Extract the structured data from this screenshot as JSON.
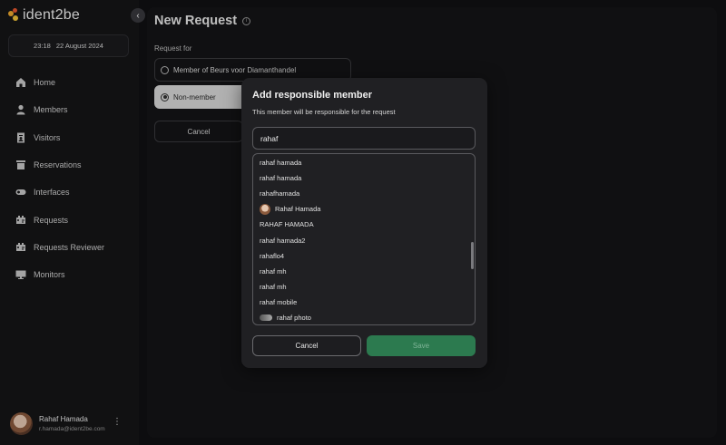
{
  "app": {
    "logo_text": "ident2be",
    "date_time": {
      "time": "23:18",
      "date": "22 August 2024"
    }
  },
  "sidebar": {
    "items": [
      {
        "label": "Home",
        "icon": "home-icon"
      },
      {
        "label": "Members",
        "icon": "person-icon"
      },
      {
        "label": "Visitors",
        "icon": "visitor-badge-icon"
      },
      {
        "label": "Reservations",
        "icon": "reservation-icon"
      },
      {
        "label": "Interfaces",
        "icon": "toggle-icon"
      },
      {
        "label": "Requests",
        "icon": "request-icon"
      },
      {
        "label": "Requests Reviewer",
        "icon": "request-reviewer-icon"
      },
      {
        "label": "Monitors",
        "icon": "monitor-icon"
      }
    ],
    "user": {
      "name": "Rahaf Hamada",
      "email": "r.hamada@ident2be.com"
    }
  },
  "page": {
    "title": "New Request",
    "request_for_label": "Request for",
    "options": [
      "Member of Beurs voor Diamanthandel",
      "Non-member"
    ],
    "selected_option": "Non-member",
    "cancel_label": "Cancel"
  },
  "modal": {
    "title": "Add responsible member",
    "subtitle": "This member will be responsible for the request",
    "search_value": "rahaf",
    "results": [
      {
        "name": "rahaf hamada",
        "avatar": "none"
      },
      {
        "name": "rahaf hamada",
        "avatar": "none"
      },
      {
        "name": "rahafhamada",
        "avatar": "none"
      },
      {
        "name": "Rahaf Hamada",
        "avatar": "photo"
      },
      {
        "name": "RAHAF HAMADA",
        "avatar": "none"
      },
      {
        "name": "rahaf hamada2",
        "avatar": "none"
      },
      {
        "name": "rahaflo4",
        "avatar": "none"
      },
      {
        "name": "rahaf mh",
        "avatar": "none"
      },
      {
        "name": "rahaf mh",
        "avatar": "none"
      },
      {
        "name": "rahaf mobile",
        "avatar": "none"
      },
      {
        "name": "rahaf photo",
        "avatar": "image"
      }
    ],
    "cancel_label": "Cancel",
    "save_label": "Save"
  },
  "colors": {
    "accent_green": "#2c7a4f",
    "background": "#111113",
    "modal_bg": "#202023"
  }
}
